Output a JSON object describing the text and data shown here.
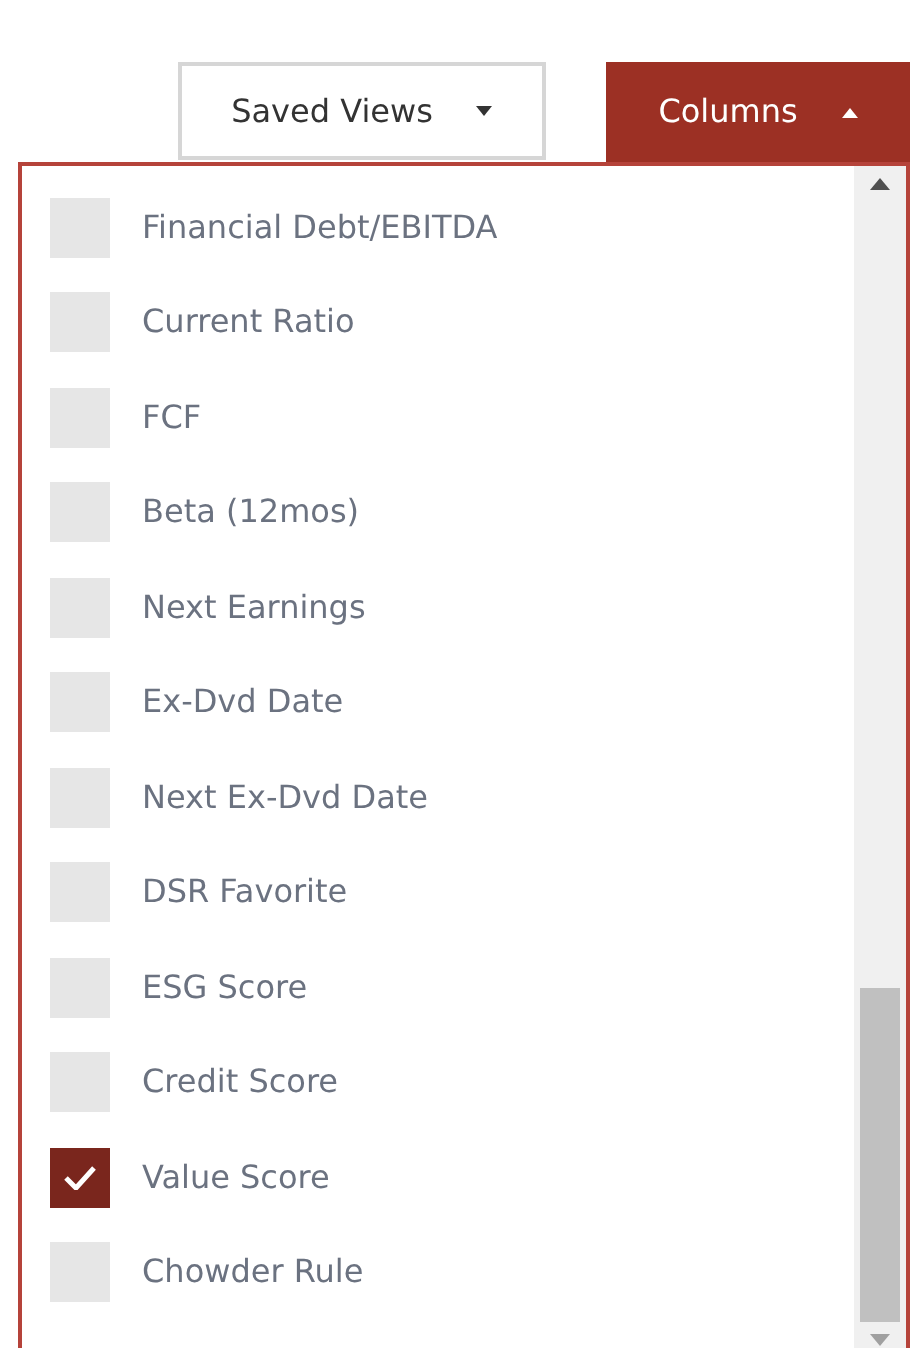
{
  "toolbar": {
    "saved_views": {
      "label": "Saved Views",
      "expanded": false
    },
    "columns": {
      "label": "Columns",
      "expanded": true
    }
  },
  "column_options": [
    {
      "label": "Financial Debt/EBITDA",
      "checked": false
    },
    {
      "label": "Current Ratio",
      "checked": false
    },
    {
      "label": "FCF",
      "checked": false
    },
    {
      "label": "Beta (12mos)",
      "checked": false
    },
    {
      "label": "Next Earnings",
      "checked": false
    },
    {
      "label": "Ex-Dvd Date",
      "checked": false
    },
    {
      "label": "Next Ex-Dvd Date",
      "checked": false
    },
    {
      "label": "DSR Favorite",
      "checked": false
    },
    {
      "label": "ESG Score",
      "checked": false
    },
    {
      "label": "Credit Score",
      "checked": false
    },
    {
      "label": "Value Score",
      "checked": true
    },
    {
      "label": "Chowder Rule",
      "checked": false
    }
  ]
}
